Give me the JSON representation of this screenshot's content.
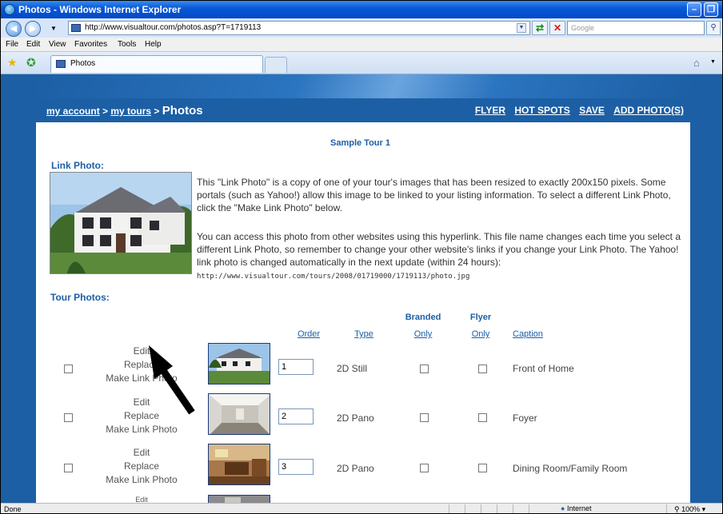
{
  "window": {
    "title": "Photos - Windows Internet Explorer",
    "url": "http://www.visualtour.com/photos.asp?T=1719113",
    "search_placeholder": "Google"
  },
  "menu": [
    "File",
    "Edit",
    "View",
    "Favorites",
    "Tools",
    "Help"
  ],
  "tab": {
    "label": "Photos"
  },
  "header": {
    "crumb_account": "my account",
    "crumb_sep1": " > ",
    "crumb_tours": "my tours",
    "crumb_sep2": " > ",
    "crumb_current": "Photos",
    "links": [
      "FLYER",
      "HOT SPOTS",
      "SAVE",
      "ADD PHOTO(S)"
    ]
  },
  "tour_name": "Sample Tour 1",
  "link_photo": {
    "heading": "Link Photo:",
    "paragraph1": "This \"Link Photo\" is a copy of one of your tour's images that has been resized to exactly 200x150 pixels. Some portals (such as Yahoo!) allow this image to be linked to your listing information. To select a different Link Photo, click the \"Make Link Photo\" below.",
    "paragraph2": "You can access this photo from other websites using this hyperlink. This file name changes each time you select a different Link Photo, so remember to change your other website's links if you change your Link Photo. The Yahoo! link photo is changed automatically in the next update (within 24 hours):",
    "photo_url": "http://www.visualtour.com/tours/2008/01719000/1719113/photo.jpg"
  },
  "tour_photos": {
    "heading": "Tour Photos:",
    "columns": {
      "order": "Order",
      "type": "Type",
      "branded_top": "Branded",
      "branded_bottom": "Only",
      "flyer_top": "Flyer",
      "flyer_bottom": "Only",
      "caption": "Caption"
    },
    "rows": [
      {
        "edit": "Edit",
        "replace": "Replace",
        "make_link": "Make Link Photo",
        "order": "1",
        "type": "2D Still",
        "caption": "Front of Home"
      },
      {
        "edit": "Edit",
        "replace": "Replace",
        "make_link": "Make Link Photo",
        "order": "2",
        "type": "2D Pano",
        "caption": "Foyer"
      },
      {
        "edit": "Edit",
        "replace": "Replace",
        "make_link": "Make Link Photo",
        "order": "3",
        "type": "2D Pano",
        "caption": "Dining Room/Family Room"
      },
      {
        "edit": "Edit"
      }
    ]
  },
  "status": {
    "text": "Done",
    "zone": "Internet",
    "zoom": "100%"
  }
}
